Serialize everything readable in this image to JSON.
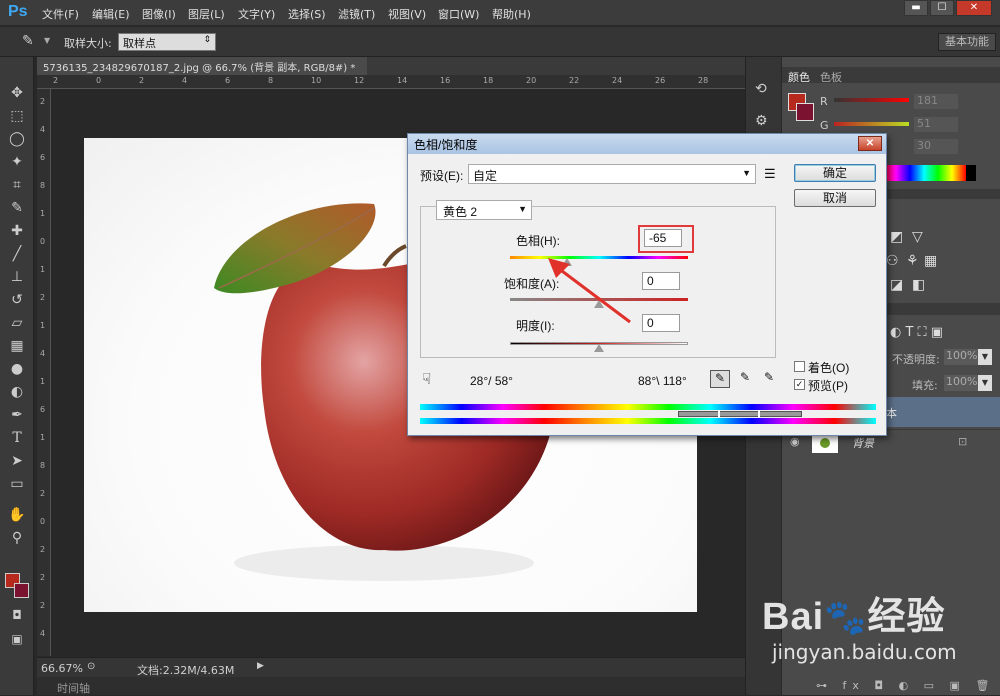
{
  "app": {
    "logo": "Ps"
  },
  "menu": [
    "文件(F)",
    "编辑(E)",
    "图像(I)",
    "图层(L)",
    "文字(Y)",
    "选择(S)",
    "滤镜(T)",
    "视图(V)",
    "窗口(W)",
    "帮助(H)"
  ],
  "window_controls": [
    "▬",
    "☐",
    "✕"
  ],
  "options": {
    "sample_size_label": "取样大小:",
    "sample_size_value": "取样点",
    "workspace": "基本功能"
  },
  "document": {
    "tab_title": "5736135_234829670187_2.jpg @ 66.7% (背景 副本, RGB/8#) *",
    "close": "×"
  },
  "ruler_h": [
    "2",
    "0",
    "2",
    "4",
    "6",
    "8",
    "10",
    "12",
    "14",
    "16",
    "18",
    "20",
    "22",
    "24",
    "26",
    "28"
  ],
  "ruler_v": [
    "2",
    "4",
    "6",
    "8",
    "1",
    "0",
    "1",
    "2",
    "1",
    "4",
    "1",
    "6",
    "1",
    "8",
    "2",
    "0",
    "2",
    "2",
    "2",
    "4"
  ],
  "status": {
    "zoom": "66.67%",
    "doc": "文档:2.32M/4.63M",
    "timeline": "时间轴"
  },
  "colors": {
    "foreground": "#b52a1c",
    "background": "#7b1330",
    "accent": "#3fa9f5"
  },
  "color_panel": {
    "tabs": [
      "颜色",
      "色板"
    ],
    "r_value": "181",
    "g_value": "51",
    "b_value": "30"
  },
  "layers_panel": {
    "opacity_label": "不透明度:",
    "opacity_value": "100%",
    "fill_label": "填充:",
    "fill_value": "100%",
    "layer_copy_suffix": "本",
    "background_layer": "背景"
  },
  "dialog": {
    "title": "色相/饱和度",
    "preset_label": "预设(E):",
    "preset_value": "自定",
    "channel_value": "黄色 2",
    "ok": "确定",
    "cancel": "取消",
    "hue_label": "色相(H):",
    "hue_value": "-65",
    "sat_label": "饱和度(A):",
    "sat_value": "0",
    "light_label": "明度(I):",
    "light_value": "0",
    "range_left": "28°/ 58°",
    "range_right": "88°\\ 118°",
    "colorize_label": "着色(O)",
    "preview_label": "预览(P)",
    "colorize_checked": false,
    "preview_checked": true,
    "hue_slider_fraction": 0.32
  },
  "watermark": {
    "brand": "Bai",
    "brand2": "经验",
    "url": "jingyan.baidu.com"
  }
}
